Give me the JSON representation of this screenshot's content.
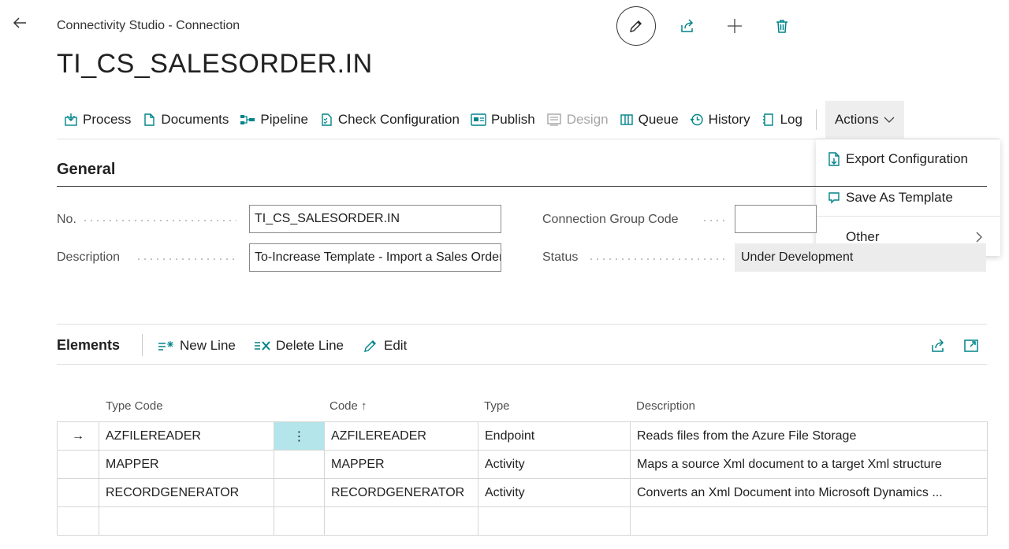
{
  "header": {
    "breadcrumb": "Connectivity Studio - Connection",
    "title": "TI_CS_SALESORDER.IN"
  },
  "actions": {
    "process": "Process",
    "documents": "Documents",
    "pipeline": "Pipeline",
    "check_configuration": "Check Configuration",
    "publish": "Publish",
    "design": "Design",
    "queue": "Queue",
    "history": "History",
    "log": "Log",
    "actions": "Actions"
  },
  "actions_menu": {
    "export_configuration": "Export Configuration",
    "save_as_template": "Save As Template",
    "other": "Other"
  },
  "general": {
    "title": "General",
    "no_label": "No.",
    "no_value": "TI_CS_SALESORDER.IN",
    "description_label": "Description",
    "description_value": "To-Increase Template - Import a Sales Order",
    "group_code_label": "Connection Group Code",
    "group_code_value": "",
    "status_label": "Status",
    "status_value": "Under Development"
  },
  "elements": {
    "title": "Elements",
    "new_line": "New Line",
    "delete_line": "Delete Line",
    "edit": "Edit",
    "columns": {
      "type_code": "Type Code",
      "code": "Code ↑",
      "type": "Type",
      "description": "Description"
    },
    "rows": [
      {
        "type_code": "AZFILEREADER",
        "menu": "⋮",
        "code": "AZFILEREADER",
        "type": "Endpoint",
        "description": "Reads files from the Azure File Storage"
      },
      {
        "type_code": "MAPPER",
        "menu": "",
        "code": "MAPPER",
        "type": "Activity",
        "description": "Maps a source Xml document to a target Xml structure"
      },
      {
        "type_code": "RECORDGENERATOR",
        "menu": "",
        "code": "RECORDGENERATOR",
        "type": "Activity",
        "description": "Converts an Xml Document into Microsoft Dynamics ..."
      },
      {
        "type_code": "",
        "menu": "",
        "code": "",
        "type": "",
        "description": ""
      }
    ],
    "current_row_marker": "→"
  },
  "colors": {
    "accent": "#008489",
    "selected_cell": "#b3e5ea",
    "text": "#212121",
    "muted": "#505050"
  }
}
